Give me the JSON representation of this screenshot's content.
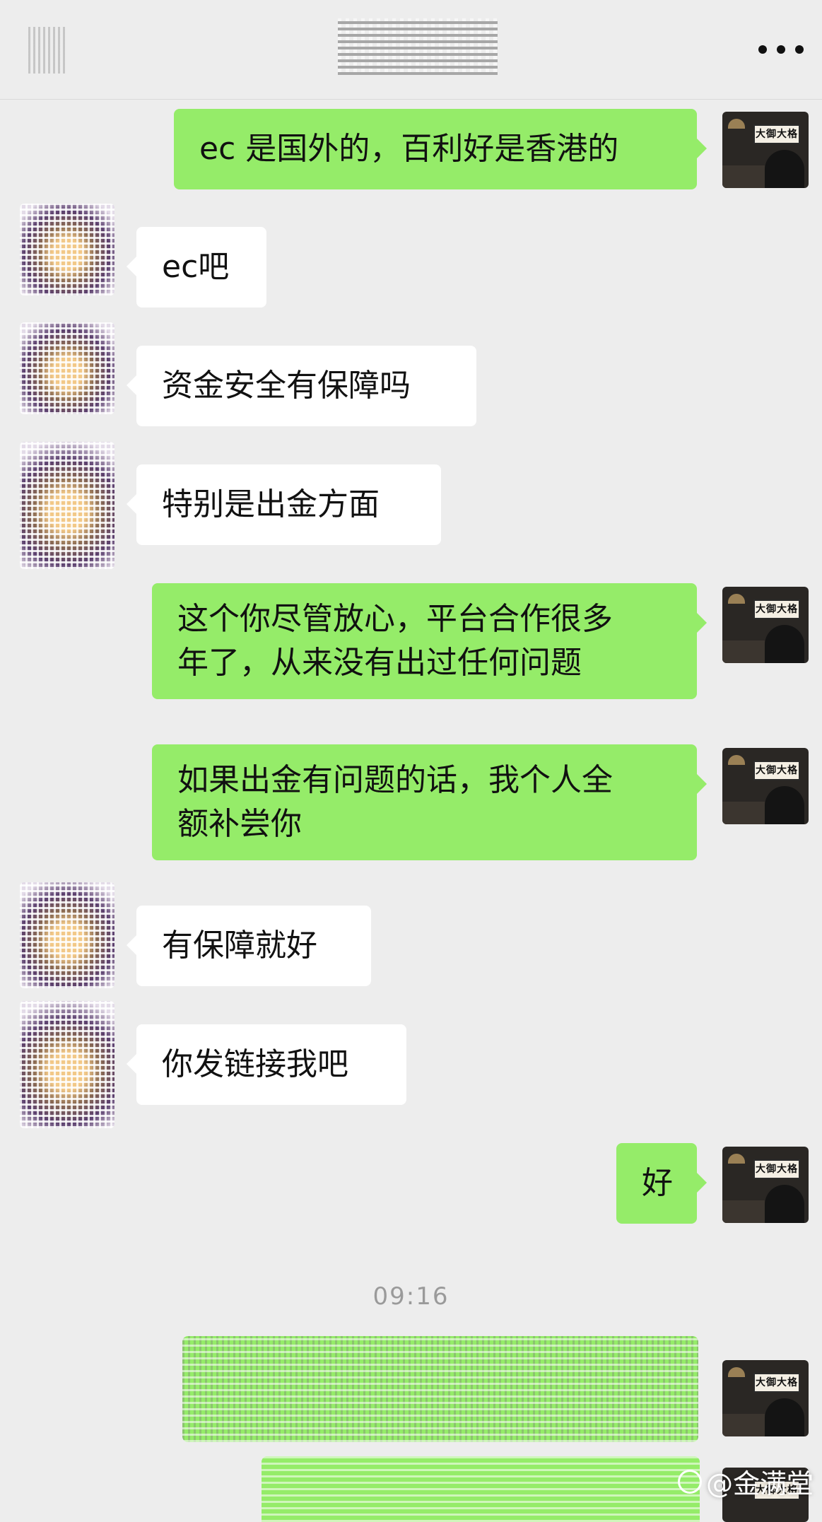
{
  "header": {
    "more_icon": "more-dots-icon",
    "back_icon": "back-arrow-icon"
  },
  "messages": [
    {
      "side": "me",
      "text": "ec 是国外的，百利好是香港的"
    },
    {
      "side": "other",
      "text": "ec吧"
    },
    {
      "side": "other",
      "text": "资金安全有保障吗"
    },
    {
      "side": "other",
      "text": "特别是出金方面"
    },
    {
      "side": "me",
      "text": "这个你尽管放心，平台合作很多\n年了，从来没有出过任何问题"
    },
    {
      "side": "me",
      "text": "如果出金有问题的话，我个人全\n额补尝你"
    },
    {
      "side": "other",
      "text": "有保障就好"
    },
    {
      "side": "other",
      "text": "你发链接我吧"
    },
    {
      "side": "me",
      "text": "好"
    }
  ],
  "timestamp": "09:16",
  "my_avatar_sign": "大御大格",
  "watermark": "@金满堂",
  "colors": {
    "background": "#ededed",
    "my_bubble": "#95ec69",
    "their_bubble": "#ffffff"
  }
}
